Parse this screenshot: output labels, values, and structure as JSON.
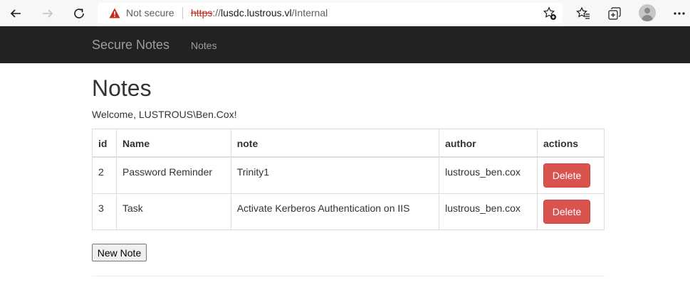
{
  "browser": {
    "security_label": "Not secure",
    "url_scheme": "https",
    "url_separator": "://",
    "url_host": "lusdc.lustrous.vl",
    "url_path": "/Internal"
  },
  "navbar": {
    "brand": "Secure Notes",
    "link": "Notes"
  },
  "page": {
    "title": "Notes",
    "welcome": "Welcome, LUSTROUS\\Ben.Cox!"
  },
  "table": {
    "headers": [
      "id",
      "Name",
      "note",
      "author",
      "actions"
    ],
    "rows": [
      {
        "id": "2",
        "name": "Password Reminder",
        "note": "Trinity1",
        "author": "lustrous_ben.cox",
        "action": "Delete"
      },
      {
        "id": "3",
        "name": "Task",
        "note": "Activate Kerberos Authentication on IIS",
        "author": "lustrous_ben.cox",
        "action": "Delete"
      }
    ]
  },
  "actions": {
    "new_note": "New Note"
  },
  "colors": {
    "navbar_bg": "#222222",
    "delete_bg": "#d9534f",
    "warning_red": "#c42b1c"
  },
  "icons": [
    "back-arrow-icon",
    "forward-arrow-icon",
    "refresh-icon",
    "warning-triangle-icon",
    "add-favorite-icon",
    "favorites-icon",
    "collections-icon",
    "profile-avatar-icon",
    "more-menu-icon"
  ]
}
